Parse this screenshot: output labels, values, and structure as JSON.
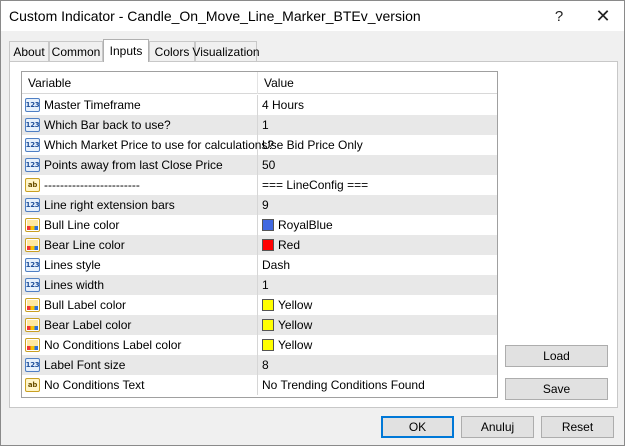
{
  "window": {
    "title": "Custom Indicator - Candle_On_Move_Line_Marker_BTEv_version",
    "help_glyph": "?",
    "close_glyph": "✕"
  },
  "tabs": [
    {
      "label": "About"
    },
    {
      "label": "Common"
    },
    {
      "label": "Inputs",
      "active": true
    },
    {
      "label": "Colors"
    },
    {
      "label": "Visualization"
    }
  ],
  "grid": {
    "headers": {
      "variable": "Variable",
      "value": "Value"
    },
    "rows": [
      {
        "icon": "number-icon",
        "icon_text": "123",
        "variable": "Master Timeframe",
        "value": "4 Hours"
      },
      {
        "icon": "number-icon",
        "icon_text": "123",
        "variable": "Which Bar back to use?",
        "value": "1"
      },
      {
        "icon": "number-icon",
        "icon_text": "123",
        "variable": "Which Market Price to use for calculations?",
        "value": "Use Bid Price Only"
      },
      {
        "icon": "number-icon",
        "icon_text": "123",
        "variable": "Points away from last Close Price",
        "value": "50"
      },
      {
        "icon": "string-icon",
        "icon_text": "ab",
        "variable": "------------------------",
        "value": "=== LineConfig ==="
      },
      {
        "icon": "number-icon",
        "icon_text": "123",
        "variable": "Line right extension bars",
        "value": "9"
      },
      {
        "icon": "color-icon",
        "variable": "Bull Line color",
        "value": "RoyalBlue",
        "swatch": "#4169e1"
      },
      {
        "icon": "color-icon",
        "variable": "Bear Line color",
        "value": "Red",
        "swatch": "#ff0000"
      },
      {
        "icon": "number-icon",
        "icon_text": "123",
        "variable": "Lines style",
        "value": "Dash"
      },
      {
        "icon": "number-icon",
        "icon_text": "123",
        "variable": "Lines width",
        "value": "1"
      },
      {
        "icon": "color-icon",
        "variable": "Bull Label color",
        "value": "Yellow",
        "swatch": "#ffff00"
      },
      {
        "icon": "color-icon",
        "variable": "Bear Label color",
        "value": "Yellow",
        "swatch": "#ffff00"
      },
      {
        "icon": "color-icon",
        "variable": "No Conditions Label color",
        "value": "Yellow",
        "swatch": "#ffff00"
      },
      {
        "icon": "number-icon",
        "icon_text": "123",
        "variable": "Label Font size",
        "value": "8"
      },
      {
        "icon": "string-icon",
        "icon_text": "ab",
        "variable": "No Conditions Text",
        "value": "No Trending Conditions Found"
      }
    ]
  },
  "buttons": {
    "load": "Load",
    "save": "Save",
    "ok": "OK",
    "cancel": "Anuluj",
    "reset": "Reset"
  }
}
